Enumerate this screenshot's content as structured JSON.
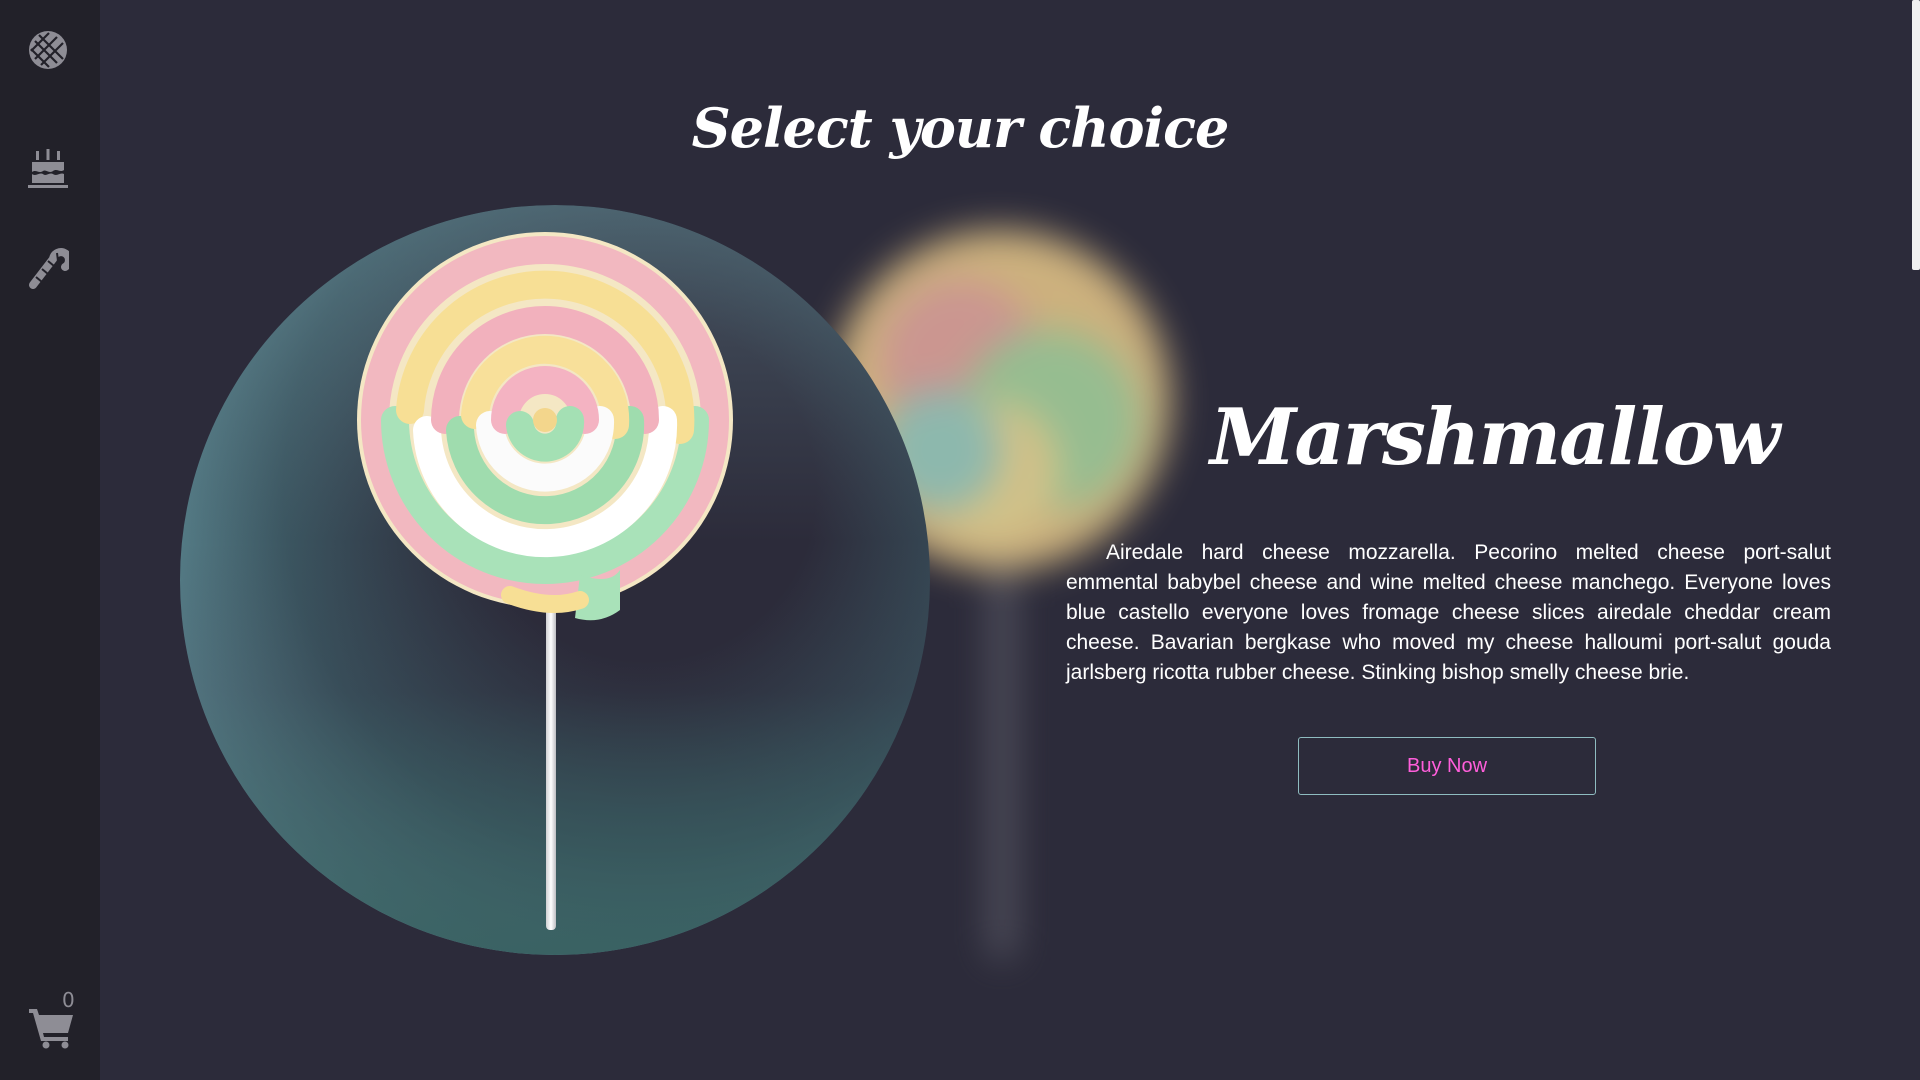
{
  "sidebar": {
    "items": [
      {
        "name": "candy-ball",
        "icon": "candy-ball-icon"
      },
      {
        "name": "cake",
        "icon": "cake-icon"
      },
      {
        "name": "candy-cane",
        "icon": "candy-cane-icon"
      }
    ],
    "cart": {
      "icon": "shopping-cart-icon",
      "count": "0"
    }
  },
  "page": {
    "heading": "Select your choice"
  },
  "product": {
    "title": "Marshmallow",
    "description": "Airedale hard cheese mozzarella. Pecorino melted cheese port-salut emmental babybel cheese and wine melted cheese manchego. Everyone loves blue castello everyone loves fromage cheese slices airedale cheddar cream cheese. Bavarian bergkase who moved my cheese halloumi port-salut gouda jarlsberg ricotta rubber cheese. Stinking bishop smelly cheese brie.",
    "buy_label": "Buy Now"
  },
  "colors": {
    "background": "#2c2b3a",
    "sidebar": "#222129",
    "accent_pink": "#ff5edb",
    "button_border": "#8fbcc0",
    "icon_gray": "#8e8d95"
  }
}
